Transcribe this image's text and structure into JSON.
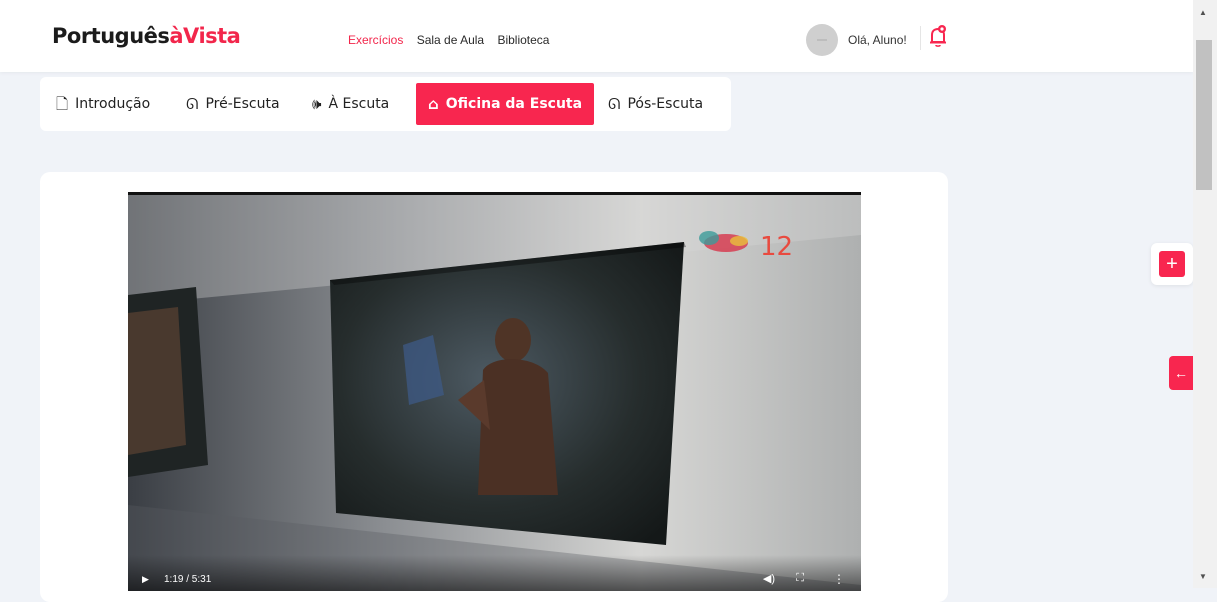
{
  "header": {
    "logo_part1": "Português",
    "logo_part2": "àVista",
    "nav": [
      {
        "label": "Exercícios",
        "active": true
      },
      {
        "label": "Sala de Aula",
        "active": false
      },
      {
        "label": "Biblioteca",
        "active": false
      }
    ],
    "greeting": "Olá, Aluno!"
  },
  "tabs": [
    {
      "label": "Introdução",
      "icon": "document-icon"
    },
    {
      "label": "Pré-Escuta",
      "icon": "ear-icon"
    },
    {
      "label": "À Escuta",
      "icon": "speaker-icon"
    },
    {
      "label": "Oficina da Escuta",
      "icon": "home-icon",
      "active": true
    },
    {
      "label": "Pós-Escuta",
      "icon": "hearing-icon"
    }
  ],
  "video": {
    "time": "1:19 / 5:31",
    "progress_fraction": 0.24,
    "watermark_number": "12"
  },
  "colors": {
    "accent": "#f8264f",
    "background": "#f0f3f8"
  }
}
